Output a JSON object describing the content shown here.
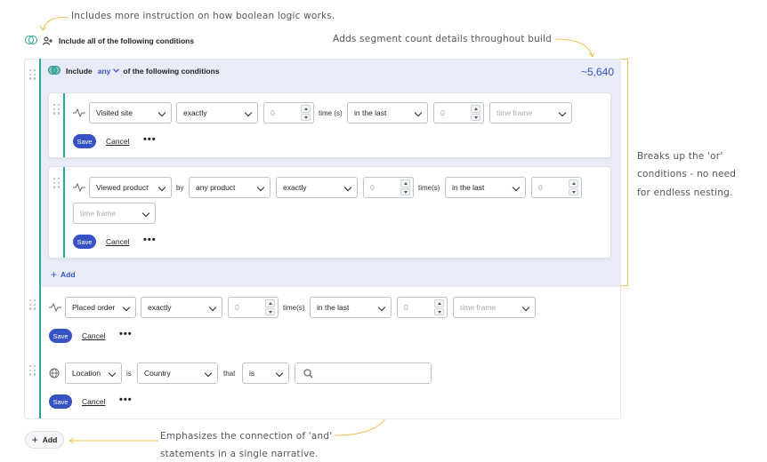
{
  "annotations": {
    "boolean_logic": "Includes more instruction on how boolean logic works.",
    "segment_count": "Adds segment count details throughout build",
    "breaks_up_1": "Breaks up the 'or'",
    "breaks_up_2": "conditions - no need",
    "breaks_up_3": "for endless nesting.",
    "emphasizes_1": "Emphasizes the connection of 'and'",
    "emphasizes_2": "statements in a single narrative."
  },
  "top_condition": {
    "label": "Include all of the following conditions"
  },
  "group": {
    "include_label": "Include",
    "any_label": "any",
    "suffix_label": "of the following conditions",
    "segment_count": "~5,640",
    "add_label": "Add"
  },
  "conditions": {
    "visited": {
      "metric": "Visited site",
      "operator": "exactly",
      "count": "0",
      "times_label": "time (s)",
      "window": "in the last",
      "window_value": "0",
      "timeframe": "time frame"
    },
    "viewed": {
      "metric": "Viewed product",
      "by_label": "by",
      "product": "any product",
      "operator": "exactly",
      "count": "0",
      "times_label": "time(s)",
      "window": "in the last",
      "window_value": "0",
      "timeframe": "time frame"
    },
    "placed": {
      "metric": "Placed order",
      "operator": "exactly",
      "count": "0",
      "times_label": "time(s)",
      "window": "in the last",
      "window_value": "0",
      "timeframe": "time frame"
    },
    "location": {
      "metric": "Location",
      "is_label": "is",
      "property": "Country",
      "that_label": "that",
      "operator": "is"
    }
  },
  "actions": {
    "save": "Save",
    "cancel": "Cancel",
    "more": "•••"
  },
  "add_outer": "Add",
  "colors": {
    "accent": "#3652c4",
    "teal": "#2aa39a",
    "annotation": "#f0c35a"
  }
}
